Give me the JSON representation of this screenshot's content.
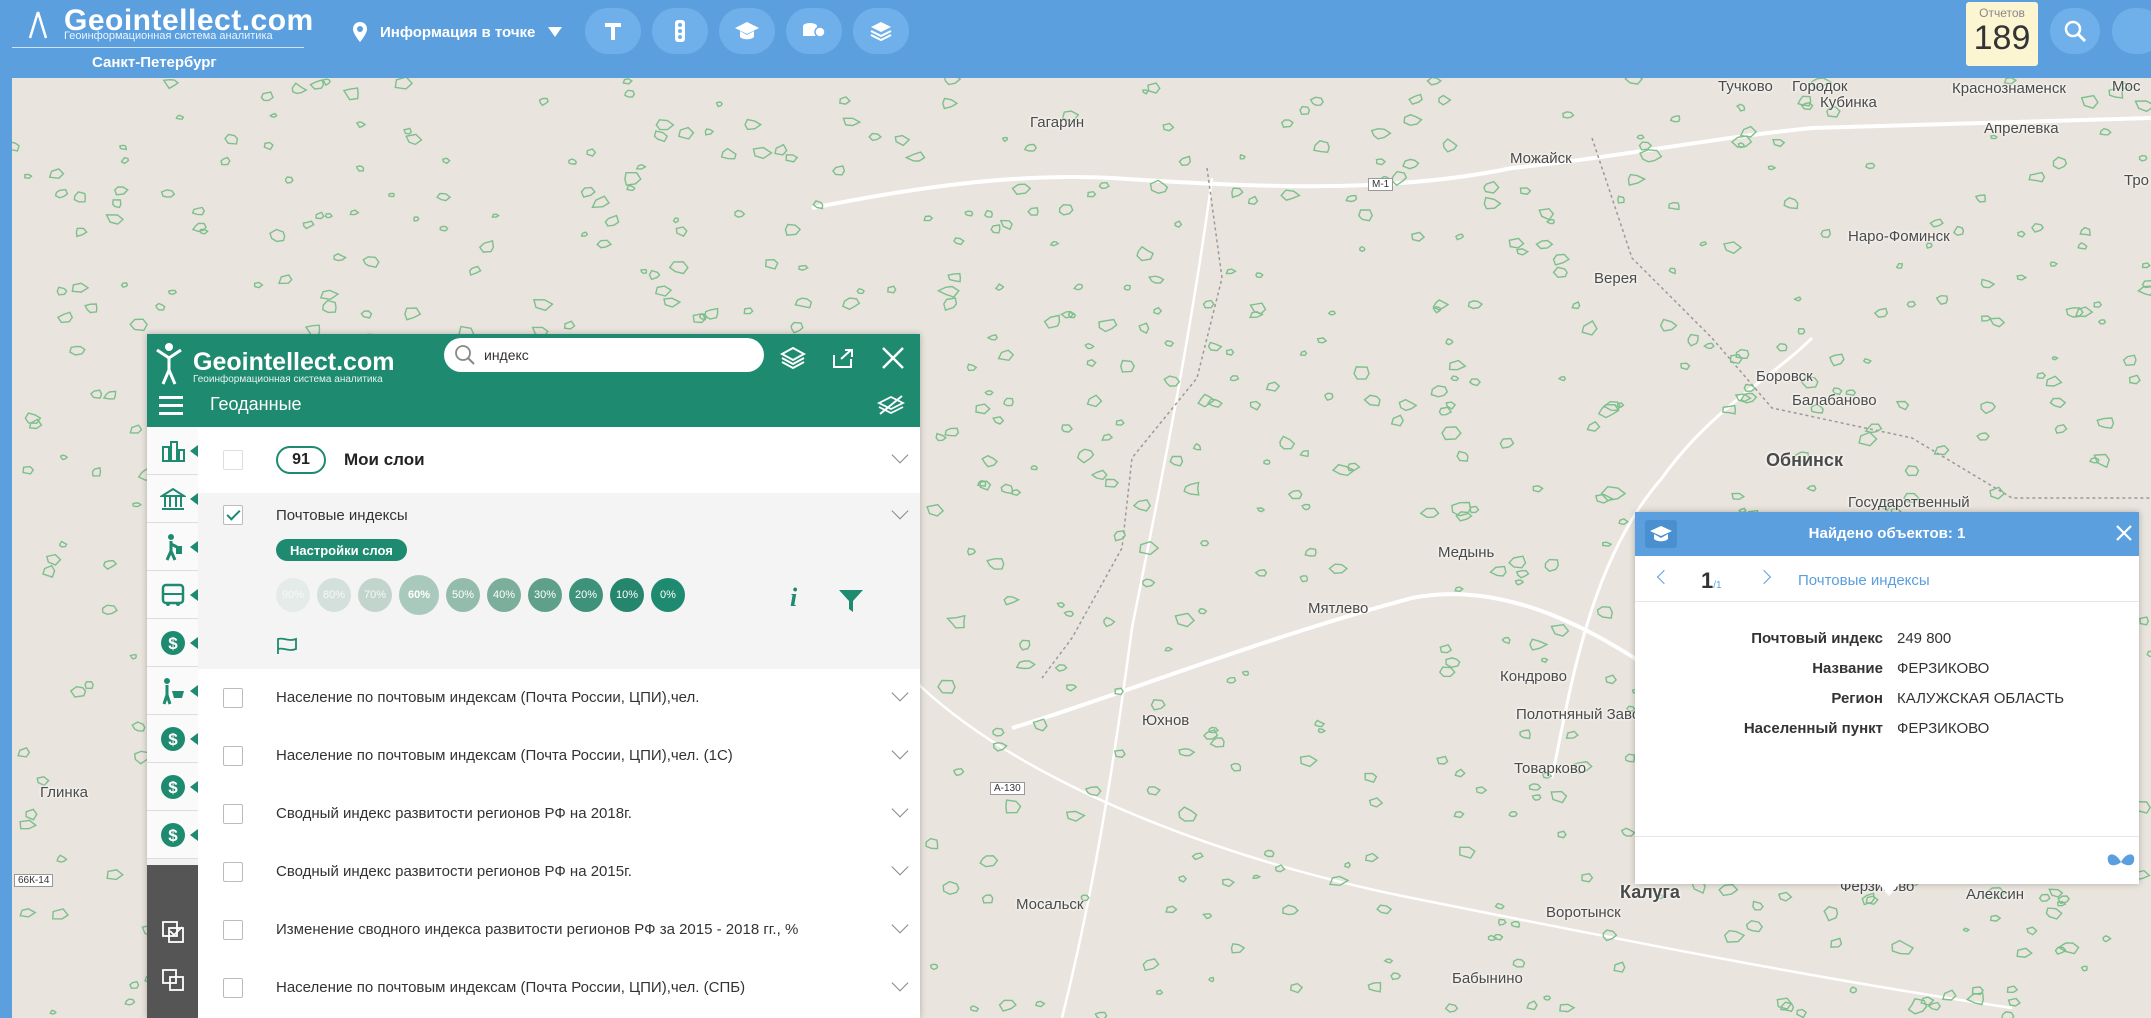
{
  "app": {
    "logo_title": "Geointellect.com",
    "logo_subtitle": "Геоинформационная система аналитика",
    "city": "Санкт-Петербург"
  },
  "toolbar": {
    "info_point_label": "Информация в точке",
    "reports_label": "Отчетов",
    "reports_count": "189"
  },
  "map": {
    "towns": [
      {
        "name": "Гагарин",
        "big": false
      },
      {
        "name": "Можайск",
        "big": false
      },
      {
        "name": "Тучково",
        "big": false
      },
      {
        "name": "Городок",
        "big": false
      },
      {
        "name": "Кубинка",
        "big": false
      },
      {
        "name": "Краснознаменск",
        "big": false
      },
      {
        "name": "Апрелевка",
        "big": false
      },
      {
        "name": "Наро-Фоминск",
        "big": false
      },
      {
        "name": "Верея",
        "big": false
      },
      {
        "name": "Боровск",
        "big": false
      },
      {
        "name": "Балабаново",
        "big": false
      },
      {
        "name": "Обнинск",
        "big": true
      },
      {
        "name": "Государственный",
        "big": false
      },
      {
        "name": "Медынь",
        "big": false
      },
      {
        "name": "Мятлево",
        "big": false
      },
      {
        "name": "Кондрово",
        "big": false
      },
      {
        "name": "Полотняный Завод",
        "big": false
      },
      {
        "name": "Юхнов",
        "big": false
      },
      {
        "name": "Товарково",
        "big": false
      },
      {
        "name": "Глинка",
        "big": false
      },
      {
        "name": "Мосальск",
        "big": false
      },
      {
        "name": "Воротынск",
        "big": false
      },
      {
        "name": "Калуга",
        "big": true
      },
      {
        "name": "Ферзиково",
        "big": false
      },
      {
        "name": "Алексин",
        "big": false
      },
      {
        "name": "Бабынино",
        "big": false
      },
      {
        "name": "Мос",
        "big": false
      },
      {
        "name": "Тро",
        "big": false
      }
    ],
    "roads": [
      "М-1",
      "А-130",
      "66К-14"
    ]
  },
  "panel": {
    "logo_title": "Geointellect",
    "logo_title_suffix": ".com",
    "logo_subtitle": "Геоинформационная система аналитика",
    "search_value": "индекс",
    "title": "Геоданные",
    "my_layers_count": "91",
    "my_layers_label": "Мои слои",
    "expanded_layer": "Почтовые индексы",
    "settings_label": "Настройки слоя",
    "opacity_levels": [
      "90%",
      "80%",
      "70%",
      "60%",
      "50%",
      "40%",
      "30%",
      "20%",
      "10%",
      "0%"
    ],
    "opacity_selected": "60%",
    "layers": [
      "Население по почтовым индексам (Почта России, ЦПИ),чел.",
      "Население по почтовым индексам (Почта России, ЦПИ),чел. (1С)",
      "Сводный индекс развитости регионов РФ на 2018г.",
      "Сводный индекс развитости регионов РФ на 2015г.",
      "Изменение сводного индекса развитости регионов РФ за 2015 - 2018 гг., %",
      "Население по почтовым индексам (Почта России, ЦПИ),чел. (СПБ)"
    ]
  },
  "popup": {
    "title": "Найдено объектов: 1",
    "page": "1",
    "page_total": "/1",
    "layer_name": "Почтовые индексы",
    "fields": [
      {
        "key": "Почтовый индекс",
        "value": "249 800"
      },
      {
        "key": "Название",
        "value": "ФЕРЗИКОВО"
      },
      {
        "key": "Регион",
        "value": "КАЛУЖСКАЯ ОБЛАСТЬ"
      },
      {
        "key": "Населенный пункт",
        "value": "ФЕРЗИКОВО"
      }
    ]
  },
  "colors": {
    "topbar": "#5b9fdf",
    "panel_accent": "#1e8a70",
    "map_bg": "#e9e4dd",
    "map_green": "#7cc08c"
  }
}
